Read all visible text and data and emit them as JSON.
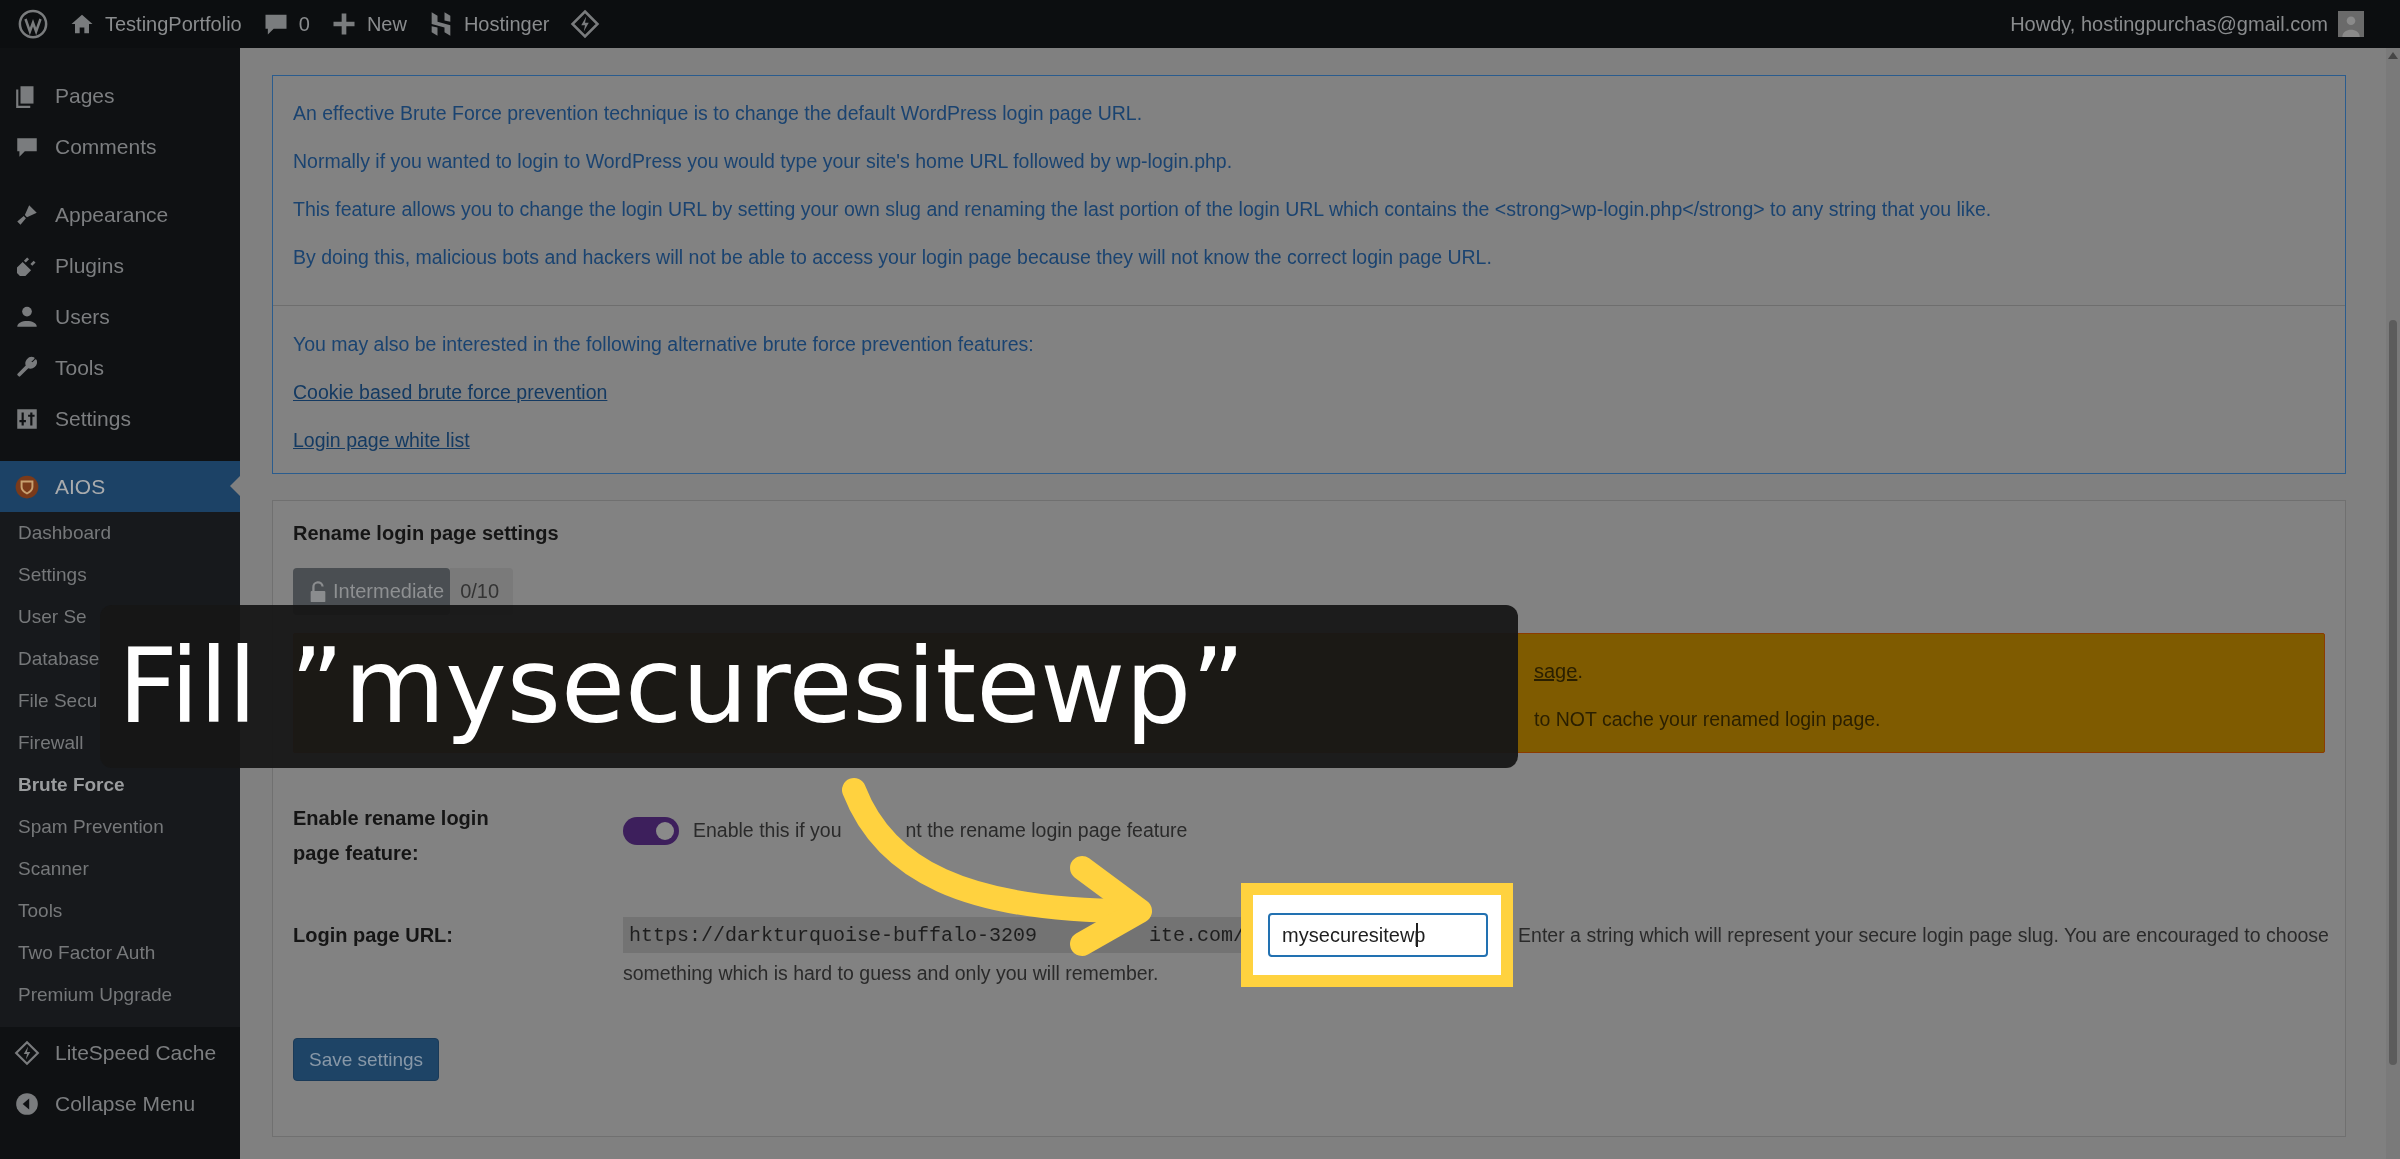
{
  "admin_bar": {
    "items": [
      {
        "kind": "logo"
      },
      {
        "kind": "home",
        "label": "TestingPortfolio"
      },
      {
        "kind": "comments",
        "label": "0"
      },
      {
        "kind": "new",
        "label": "New"
      },
      {
        "kind": "hostinger",
        "label": "Hostinger"
      },
      {
        "kind": "litespeed"
      }
    ],
    "account": "Howdy, hostingpurchas@gmail.com"
  },
  "sidebar": {
    "groups": [
      [
        {
          "kind": "pages",
          "label": "Pages",
          "selected": false
        },
        {
          "kind": "comments",
          "label": "Comments",
          "selected": false
        }
      ],
      [
        {
          "kind": "appearance",
          "label": "Appearance",
          "selected": false
        },
        {
          "kind": "plugins",
          "label": "Plugins",
          "selected": false
        },
        {
          "kind": "users",
          "label": "Users",
          "selected": false
        },
        {
          "kind": "tools",
          "label": "Tools",
          "selected": false
        },
        {
          "kind": "settings",
          "label": "Settings",
          "selected": false
        }
      ],
      [
        {
          "kind": "aios",
          "label": "AIOS",
          "selected": true,
          "children": [
            {
              "label": "Dashboard",
              "selected": false
            },
            {
              "label": "Settings",
              "selected": false
            },
            {
              "label": "User Se",
              "selected": false
            },
            {
              "label": "Database",
              "selected": false
            },
            {
              "label": "File Secu",
              "selected": false
            },
            {
              "label": "Firewall",
              "selected": false
            },
            {
              "label": "Brute Force",
              "selected": true
            },
            {
              "label": "Spam Prevention",
              "selected": false
            },
            {
              "label": "Scanner",
              "selected": false
            },
            {
              "label": "Tools",
              "selected": false
            },
            {
              "label": "Two Factor Auth",
              "selected": false
            },
            {
              "label": "Premium Upgrade",
              "selected": false
            }
          ]
        },
        {
          "kind": "litespeed",
          "label": "LiteSpeed Cache",
          "selected": false
        },
        {
          "kind": "collapse",
          "label": "Collapse Menu",
          "selected": false
        }
      ]
    ]
  },
  "info_box": {
    "paragraphs": [
      "An effective Brute Force prevention technique is to change the default WordPress login page URL.",
      "Normally if you wanted to login to WordPress you would type your site's home URL followed by wp-login.php.",
      "This feature allows you to change the login URL by setting your own slug and renaming the last portion of the login URL which contains the <strong>wp-login.php</strong> to any string that you like.",
      "By doing this, malicious bots and hackers will not be able to access your login page because they will not know the correct login page URL."
    ],
    "related_intro": "You may also be interested in the following alternative brute force prevention features:",
    "links": [
      "Cookie based brute force prevention",
      "Login page white list"
    ]
  },
  "settings_panel": {
    "title": "Rename login page settings",
    "badge": {
      "label": "Intermediate",
      "score": "0/10"
    },
    "warnings": [
      {
        "link": "sage",
        "after": "."
      },
      {
        "text": "to NOT cache your renamed login page."
      }
    ],
    "fields": [
      {
        "kind": "toggle",
        "label": "Enable rename login page feature:",
        "on": true,
        "description_before": "Enable this if you",
        "description_after": "nt the rename login page feature"
      },
      {
        "kind": "url",
        "label": "Login page URL:",
        "url_prefix": "https://darkturquoise-buffalo-3209",
        "url_suffix": "ite.com/",
        "value": "mysecuresitewp",
        "description_lines": [
          "Enter a string which will represent your secure login page slug. You are encouraged to choose",
          "something which is hard to guess and only you will remember."
        ]
      }
    ],
    "save_button": "Save settings"
  },
  "tutorial": {
    "caption": "Fill ”mysecuresitewp”"
  }
}
